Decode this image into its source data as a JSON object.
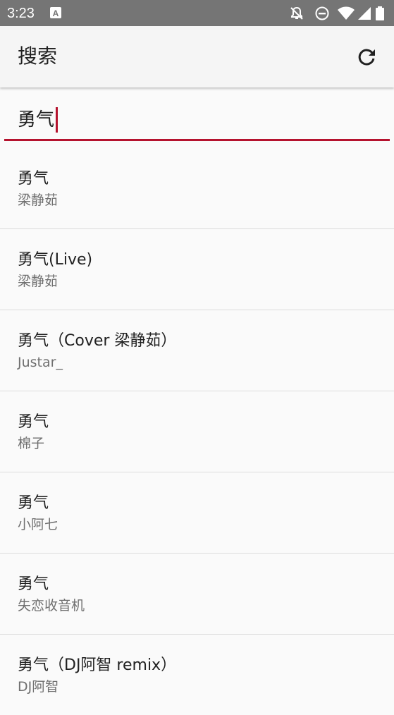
{
  "status_bar": {
    "time": "3:23",
    "icons": [
      "notification-a-icon",
      "alarm-off-icon",
      "do-not-disturb-icon",
      "wifi-icon",
      "signal-icon",
      "battery-icon"
    ]
  },
  "toolbar": {
    "title": "搜索",
    "refresh_icon": "refresh-icon"
  },
  "search": {
    "value": "勇气",
    "accent_color": "#b5122e"
  },
  "results": [
    {
      "title": "勇气",
      "artist": "梁静茹"
    },
    {
      "title": "勇气(Live)",
      "artist": "梁静茹"
    },
    {
      "title": "勇气（Cover 梁静茹）",
      "artist": "Justar_"
    },
    {
      "title": "勇气",
      "artist": "棉子"
    },
    {
      "title": "勇气",
      "artist": "小阿七"
    },
    {
      "title": "勇气",
      "artist": "失恋收音机"
    },
    {
      "title": "勇气（DJ阿智 remix）",
      "artist": "DJ阿智"
    }
  ]
}
